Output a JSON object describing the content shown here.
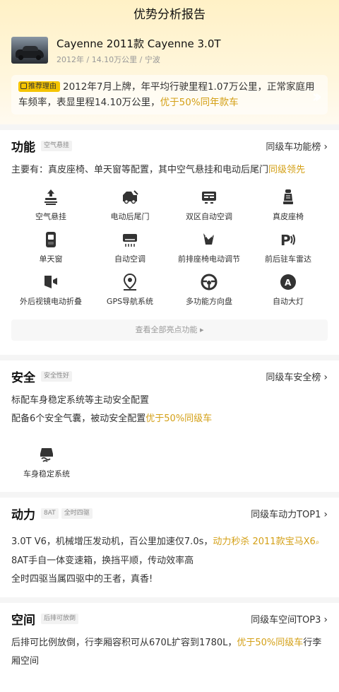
{
  "page": {
    "title": "优势分析报告"
  },
  "car": {
    "name": "Cayenne 2011款 Cayenne 3.0T",
    "meta": "2012年 / 14.10万公里 / 宁波"
  },
  "reason": {
    "tag": "推荐理由",
    "text": "2012年7月上牌，年平均行驶里程1.07万公里，正常家庭用车频率，表显里程14.10万公里，",
    "highlight": "优于50%同年款车"
  },
  "function": {
    "title": "功能",
    "badge": "空气悬挂",
    "rank": "同级车功能榜",
    "summary": "主要有：真皮座椅、单天窗等配置，其中空气悬挂和电动后尾门",
    "summary_highlight": "同级领先",
    "features": [
      {
        "label": "空气悬挂",
        "icon": "air-suspension-icon"
      },
      {
        "label": "电动后尾门",
        "icon": "power-tailgate-icon"
      },
      {
        "label": "双区自动空调",
        "icon": "dual-zone-ac-icon"
      },
      {
        "label": "真皮座椅",
        "icon": "leather-seat-icon"
      },
      {
        "label": "单天窗",
        "icon": "sunroof-icon"
      },
      {
        "label": "自动空调",
        "icon": "auto-ac-icon"
      },
      {
        "label": "前排座椅电动调节",
        "icon": "power-seat-icon"
      },
      {
        "label": "前后驻车雷达",
        "icon": "parking-radar-icon"
      },
      {
        "label": "外后视镜电动折叠",
        "icon": "mirror-fold-icon"
      },
      {
        "label": "GPS导航系统",
        "icon": "gps-icon"
      },
      {
        "label": "多功能方向盘",
        "icon": "steering-wheel-icon"
      },
      {
        "label": "自动大灯",
        "icon": "auto-headlight-icon"
      }
    ],
    "more": "查看全部亮点功能 ▸"
  },
  "safety": {
    "title": "安全",
    "badge": "安全性好",
    "rank": "同级车安全榜",
    "line1": "标配车身稳定系统等主动安全配置",
    "line2": "配备6个安全气囊，被动安全配置",
    "line2_highlight": "优于50%同级车",
    "feature": {
      "label": "车身稳定系统",
      "icon": "stability-control-icon"
    }
  },
  "power": {
    "title": "动力",
    "badge1": "8AT",
    "badge2": "全时四驱",
    "rank": "同级车动力TOP1",
    "line1": "3.0T V6，机械增压发动机，百公里加速仅7.0s，",
    "line1_highlight": "动力秒杀 2011款宝马X6",
    "line2": "8AT手自一体变速箱，换挡平顺，传动效率高",
    "line3": "全时四驱当属四驱中的王者，真香!"
  },
  "space": {
    "title": "空间",
    "badge": "后排可放倒",
    "rank": "同级车空间TOP3",
    "line1": "后排可比例放倒，行李厢容积可从670L扩容到1780L，",
    "line1_highlight": "优于50%同级车",
    "line1_tail": "行李厢空间"
  },
  "colors": {
    "accent": "#d4a017",
    "tag": "#f5c400"
  }
}
